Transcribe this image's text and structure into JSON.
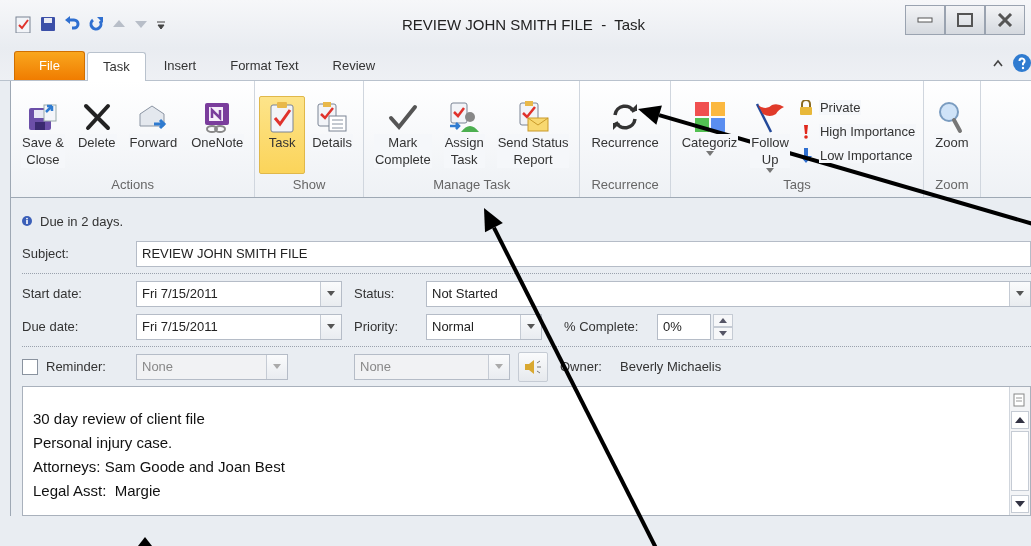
{
  "window": {
    "title": "REVIEW JOHN SMITH FILE  -  Task"
  },
  "tabs": [
    {
      "label": "File",
      "kind": "file",
      "selected": false
    },
    {
      "label": "Task",
      "kind": "tab",
      "selected": true
    },
    {
      "label": "Insert",
      "kind": "tab",
      "selected": false
    },
    {
      "label": "Format Text",
      "kind": "tab",
      "selected": false
    },
    {
      "label": "Review",
      "kind": "tab",
      "selected": false
    }
  ],
  "ribbon": [
    {
      "label": "Actions",
      "buttons": [
        {
          "label": "Save &\nClose",
          "kind": "large",
          "selected": false
        },
        {
          "label": "Delete",
          "kind": "large",
          "selected": false
        },
        {
          "label": "Forward",
          "kind": "large",
          "selected": false
        },
        {
          "label": "OneNote",
          "kind": "large",
          "selected": false
        }
      ]
    },
    {
      "label": "Show",
      "buttons": [
        {
          "label": "Task",
          "kind": "large",
          "selected": true
        },
        {
          "label": "Details",
          "kind": "large",
          "selected": false
        }
      ]
    },
    {
      "label": "Manage Task",
      "buttons": [
        {
          "label": "Mark\nComplete",
          "kind": "large",
          "selected": false
        },
        {
          "label": "Assign\nTask",
          "kind": "large",
          "selected": false
        },
        {
          "label": "Send Status\nReport",
          "kind": "large",
          "selected": false
        }
      ]
    },
    {
      "label": "Recurrence",
      "buttons": [
        {
          "label": "Recurrence",
          "kind": "large",
          "selected": false
        }
      ]
    },
    {
      "label": "Tags",
      "buttons": [
        {
          "label": "Categoriz",
          "kind": "large",
          "selected": false,
          "dropdown": true
        },
        {
          "label": "Follow\nUp",
          "kind": "large",
          "selected": false,
          "dropdown": true
        },
        {
          "label": "Private",
          "kind": "small",
          "selected": false
        },
        {
          "label": "High Importance",
          "kind": "small",
          "selected": false
        },
        {
          "label": "Low Importance",
          "kind": "small",
          "selected": false
        }
      ]
    },
    {
      "label": "Zoom",
      "buttons": [
        {
          "label": "Zoom",
          "kind": "large",
          "selected": false
        }
      ]
    }
  ],
  "info": "Due in 2 days.",
  "subject": {
    "label": "Subject:",
    "value": "REVIEW JOHN SMITH FILE"
  },
  "start_date": {
    "label": "Start date:",
    "value": "Fri 7/15/2011"
  },
  "due_date": {
    "label": "Due date:",
    "value": "Fri 7/15/2011"
  },
  "status": {
    "label": "Status:",
    "value": "Not Started"
  },
  "priority": {
    "label": "Priority:",
    "value": "Normal"
  },
  "percent_complete": {
    "label": "% Complete:",
    "value": "0%"
  },
  "reminder": {
    "label": "Reminder:",
    "checked": false,
    "date": "None",
    "time": "None",
    "disabled": true
  },
  "owner": {
    "label": "Owner:",
    "value": "Beverly Michaelis"
  },
  "notes": [
    "30 day review of client file",
    "Personal injury case.",
    "Attorneys: Sam Goode and Joan Best",
    "Legal Asst:  Margie"
  ]
}
